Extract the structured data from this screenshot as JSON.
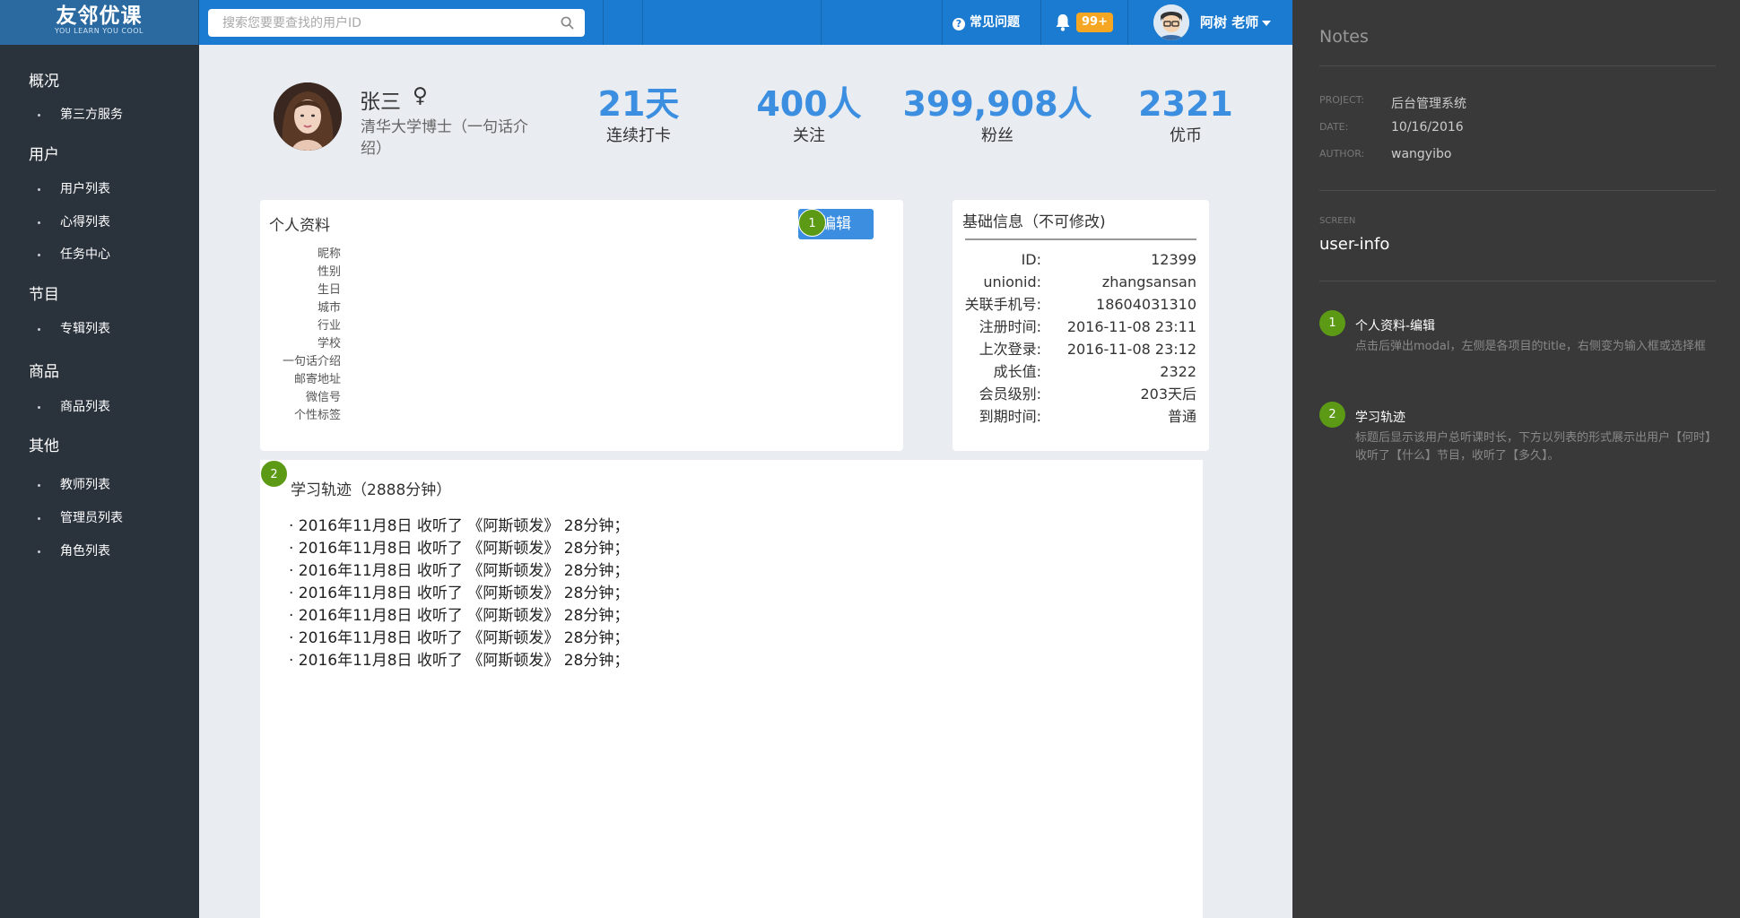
{
  "brand": {
    "logo_main": "友邻优课",
    "logo_sub": "YOU LEARN YOU COOL"
  },
  "search": {
    "placeholder": "搜索您要要查找的用户ID",
    "icon": "search-icon"
  },
  "header": {
    "faq_label": "常见问题",
    "faq_icon": "question-circle-icon",
    "bell_icon": "bell-icon",
    "notifications": "99+",
    "user_name": "阿树 老师",
    "user_icon": "caret-down-icon"
  },
  "sidebar": {
    "groups": [
      {
        "label": "概况",
        "items": [
          "第三方服务"
        ]
      },
      {
        "label": "用户",
        "items": [
          "用户列表",
          "心得列表",
          "任务中心"
        ]
      },
      {
        "label": "节目",
        "items": [
          "专辑列表"
        ]
      },
      {
        "label": "商品",
        "items": [
          "商品列表"
        ]
      },
      {
        "label": "其他",
        "items": [
          "教师列表",
          "管理员列表",
          "角色列表"
        ]
      }
    ]
  },
  "profile": {
    "name": "张三",
    "gender_symbol": "♀",
    "intro": "清华大学博士（一句话介绍）",
    "stats": [
      {
        "value": "21天",
        "label": "连续打卡"
      },
      {
        "value": "400人",
        "label": "关注"
      },
      {
        "value": "399,908人",
        "label": "粉丝"
      },
      {
        "value": "2321",
        "label": "优币"
      }
    ]
  },
  "personal": {
    "title": "个人资料",
    "edit_label": "编辑",
    "fields": [
      "昵称",
      "性别",
      "生日",
      "城市",
      "行业",
      "学校",
      "一句话介绍",
      "邮寄地址",
      "微信号",
      "个性标签"
    ]
  },
  "basic": {
    "title": "基础信息（不可修改)",
    "rows": [
      {
        "label": "ID:",
        "value": "12399"
      },
      {
        "label": "unionid:",
        "value": "zhangsansan"
      },
      {
        "label": "关联手机号:",
        "value": "18604031310"
      },
      {
        "label": "注册时间:",
        "value": "2016-11-08 23:11"
      },
      {
        "label": "上次登录:",
        "value": "2016-11-08 23:12"
      },
      {
        "label": "成长值:",
        "value": "2322"
      },
      {
        "label": "会员级别:",
        "value": "203天后"
      },
      {
        "label": "到期时间:",
        "value": "普通"
      }
    ]
  },
  "history": {
    "title": "学习轨迹（2888分钟）",
    "items": [
      "· 2016年11月8日 收听了 《阿斯顿发》 28分钟；",
      "· 2016年11月8日 收听了 《阿斯顿发》 28分钟；",
      "· 2016年11月8日 收听了 《阿斯顿发》 28分钟；",
      "· 2016年11月8日 收听了 《阿斯顿发》 28分钟；",
      "· 2016年11月8日 收听了 《阿斯顿发》 28分钟；",
      "· 2016年11月8日 收听了 《阿斯顿发》 28分钟；",
      "· 2016年11月8日 收听了 《阿斯顿发》 28分钟；"
    ]
  },
  "markers": [
    "1",
    "2"
  ],
  "notes": {
    "title": "Notes",
    "meta": [
      {
        "key": "PROJECT:",
        "value": "后台管理系统"
      },
      {
        "key": "DATE:",
        "value": "10/16/2016"
      },
      {
        "key": "AUTHOR:",
        "value": "wangyibo"
      }
    ],
    "screen_key": "SCREEN",
    "screen_value": "user-info",
    "annotations": [
      {
        "num": "1",
        "title": "个人资料-编辑",
        "desc": "点击后弹出modal，左侧是各项目的title，右侧变为输入框或选择框"
      },
      {
        "num": "2",
        "title": "学习轨迹",
        "desc": "标题后显示该用户总听课时长，下方以列表的形式展示出用户【何时】收听了【什么】节目，收听了【多久】。"
      }
    ]
  },
  "colors": {
    "topbar": "#1a7bd0",
    "sidebar": "#2a323c",
    "accent": "#3b8ee0",
    "marker": "#5c9a16",
    "notes_bg": "#393939",
    "badge": "#f5a623"
  }
}
